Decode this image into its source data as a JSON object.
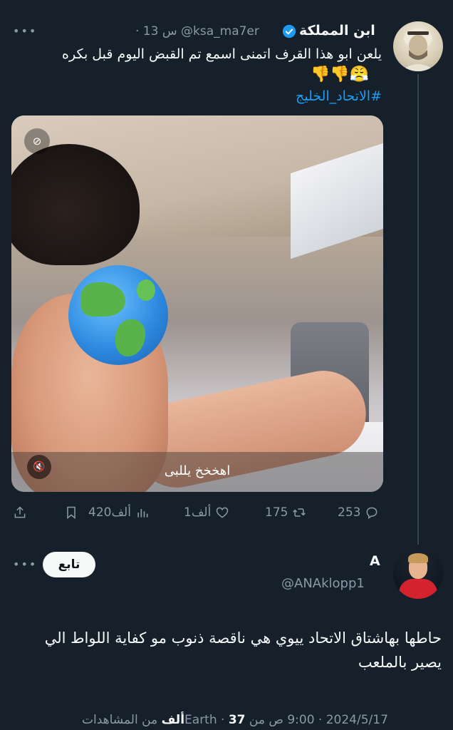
{
  "tweet": {
    "author_name": "ابن المملكة",
    "handle": "@ksa_ma7er",
    "time": "· 13 س",
    "text": "يلعن ابو هذا القرف اتمنى اسمع تم القبض اليوم قبل بكره",
    "emojis": "👎👎😤",
    "hashtag": "#الاتحاد_الخليج",
    "media": {
      "caption": "اهخخخ يللبى",
      "gif_badge": "GIF-off-icon",
      "mute_icon": "mute-icon"
    },
    "actions": {
      "replies": "253",
      "retweets": "175",
      "likes": "1ألف",
      "views": "420ألف"
    }
  },
  "reply": {
    "author_name": "A",
    "handle": "@ANAklopp1",
    "follow_label": "تابع",
    "text": "حاطها بهاشتاق الاتحاد ييوي هي ناقصة ذنوب مو كفاية اللواط الي يصير بالملعب",
    "meta_date_time": "2024/5/17 · 9:00 ص من Earth ·",
    "meta_views_count": "37ألف",
    "meta_views_label": "من المشاهدات"
  },
  "colors": {
    "background": "#15202b",
    "accent": "#1d9bf0",
    "muted": "#8b98a5"
  }
}
